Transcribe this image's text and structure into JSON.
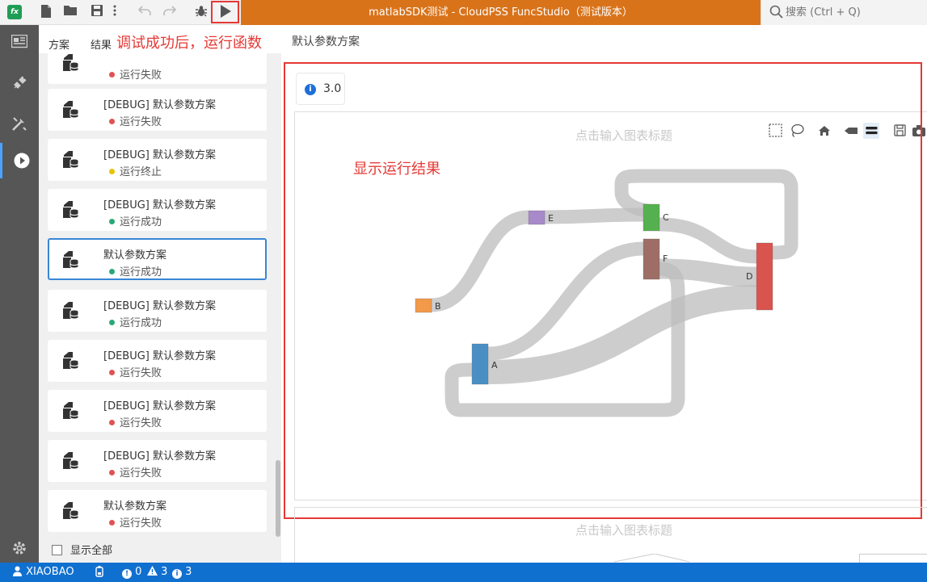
{
  "window": {
    "title": "matlabSDK测试 - CloudPSS FuncStudio（测试版本）",
    "app_logo": "fx"
  },
  "search": {
    "placeholder": "搜索 (Ctrl + Q)"
  },
  "tabs": [
    {
      "label": "方案"
    },
    {
      "label": "结果"
    }
  ],
  "annotations": {
    "run_hint": "调试成功后，运行函数",
    "result_hint": "显示运行结果"
  },
  "breadcrumb": "默认参数方案",
  "list": {
    "items": [
      {
        "name": "",
        "status": "运行失败",
        "status_color": "#e05252"
      },
      {
        "name": "[DEBUG] 默认参数方案",
        "status": "运行失败",
        "status_color": "#e05252"
      },
      {
        "name": "[DEBUG] 默认参数方案",
        "status": "运行终止",
        "status_color": "#e8c300"
      },
      {
        "name": "[DEBUG] 默认参数方案",
        "status": "运行成功",
        "status_color": "#2aa876"
      },
      {
        "name": "默认参数方案",
        "status": "运行成功",
        "status_color": "#2aa876",
        "selected": true
      },
      {
        "name": "[DEBUG] 默认参数方案",
        "status": "运行成功",
        "status_color": "#2aa876"
      },
      {
        "name": "[DEBUG] 默认参数方案",
        "status": "运行失败",
        "status_color": "#e05252"
      },
      {
        "name": "[DEBUG] 默认参数方案",
        "status": "运行失败",
        "status_color": "#e05252"
      },
      {
        "name": "[DEBUG] 默认参数方案",
        "status": "运行失败",
        "status_color": "#e05252"
      },
      {
        "name": "默认参数方案",
        "status": "运行失败",
        "status_color": "#e05252"
      }
    ],
    "show_all_label": "显示全部"
  },
  "result": {
    "version": "3.0",
    "chart_title_placeholder": "点击输入图表标题",
    "chart_title_placeholder_2": "点击输入图表标题"
  },
  "chart_data": {
    "type": "sankey",
    "nodes": [
      {
        "name": "A",
        "color": "#4a8fc4"
      },
      {
        "name": "B",
        "color": "#f2994a"
      },
      {
        "name": "C",
        "color": "#55b14f"
      },
      {
        "name": "D",
        "color": "#d9534f"
      },
      {
        "name": "E",
        "color": "#a889c9"
      },
      {
        "name": "F",
        "color": "#9e6e66"
      }
    ],
    "links": [
      {
        "source": "B",
        "target": "E"
      },
      {
        "source": "E",
        "target": "C"
      },
      {
        "source": "C",
        "target": "D"
      },
      {
        "source": "F",
        "target": "D"
      },
      {
        "source": "A",
        "target": "F"
      },
      {
        "source": "A",
        "target": "D"
      },
      {
        "source": "F",
        "target": "A"
      }
    ]
  },
  "statusbar": {
    "user": "XIAOBAO",
    "errors": "0",
    "warnings": "3",
    "infos": "3"
  },
  "colors": {
    "accent": "#d9731a",
    "status_bar": "#1070d0",
    "annotation": "#e53935"
  }
}
